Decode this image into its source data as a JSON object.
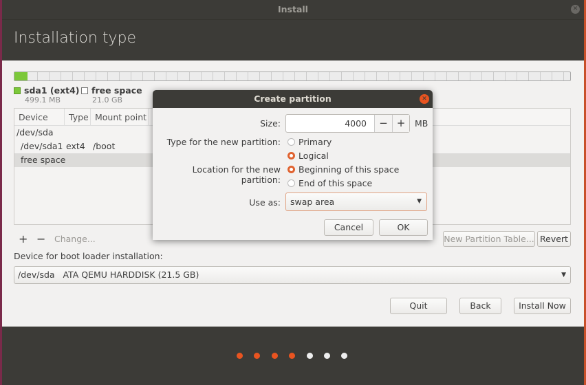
{
  "window": {
    "title": "Install",
    "page_title": "Installation type"
  },
  "legend": [
    {
      "name": "sda1 (ext4)",
      "size": "499.1 MB",
      "color": "#7cc83a"
    },
    {
      "name": "free space",
      "size": "21.0 GB",
      "color": "#ffffff"
    }
  ],
  "disk_usage_fraction": 0.023,
  "table": {
    "columns": [
      "Device",
      "Type",
      "Mount point"
    ],
    "rows": [
      {
        "device": "/dev/sda",
        "type": "",
        "mount": ""
      },
      {
        "device": "/dev/sda1",
        "type": "ext4",
        "mount": "/boot"
      },
      {
        "device": "free space",
        "type": "",
        "mount": "",
        "selected": true
      }
    ]
  },
  "toolbar": {
    "add": "+",
    "remove": "−",
    "change": "Change...",
    "new_table": "New Partition Table...",
    "revert": "Revert"
  },
  "bootloader": {
    "label": "Device for boot loader installation:",
    "value": "/dev/sda   ATA QEMU HARDDISK (21.5 GB)"
  },
  "buttons": {
    "quit": "Quit",
    "back": "Back",
    "install": "Install Now"
  },
  "progress_dots": {
    "total": 7,
    "completed": 4,
    "active_color": "#e95420"
  },
  "dialog": {
    "title": "Create partition",
    "size_label": "Size:",
    "size_value": "4000",
    "minus": "−",
    "plus": "+",
    "unit": "MB",
    "type_label": "Type for the new partition:",
    "type_options": [
      "Primary",
      "Logical"
    ],
    "type_selected": "Logical",
    "location_label": "Location for the new partition:",
    "location_options": [
      "Beginning of this space",
      "End of this space"
    ],
    "location_selected": "Beginning of this space",
    "use_as_label": "Use as:",
    "use_as_value": "swap area",
    "cancel": "Cancel",
    "ok": "OK"
  }
}
